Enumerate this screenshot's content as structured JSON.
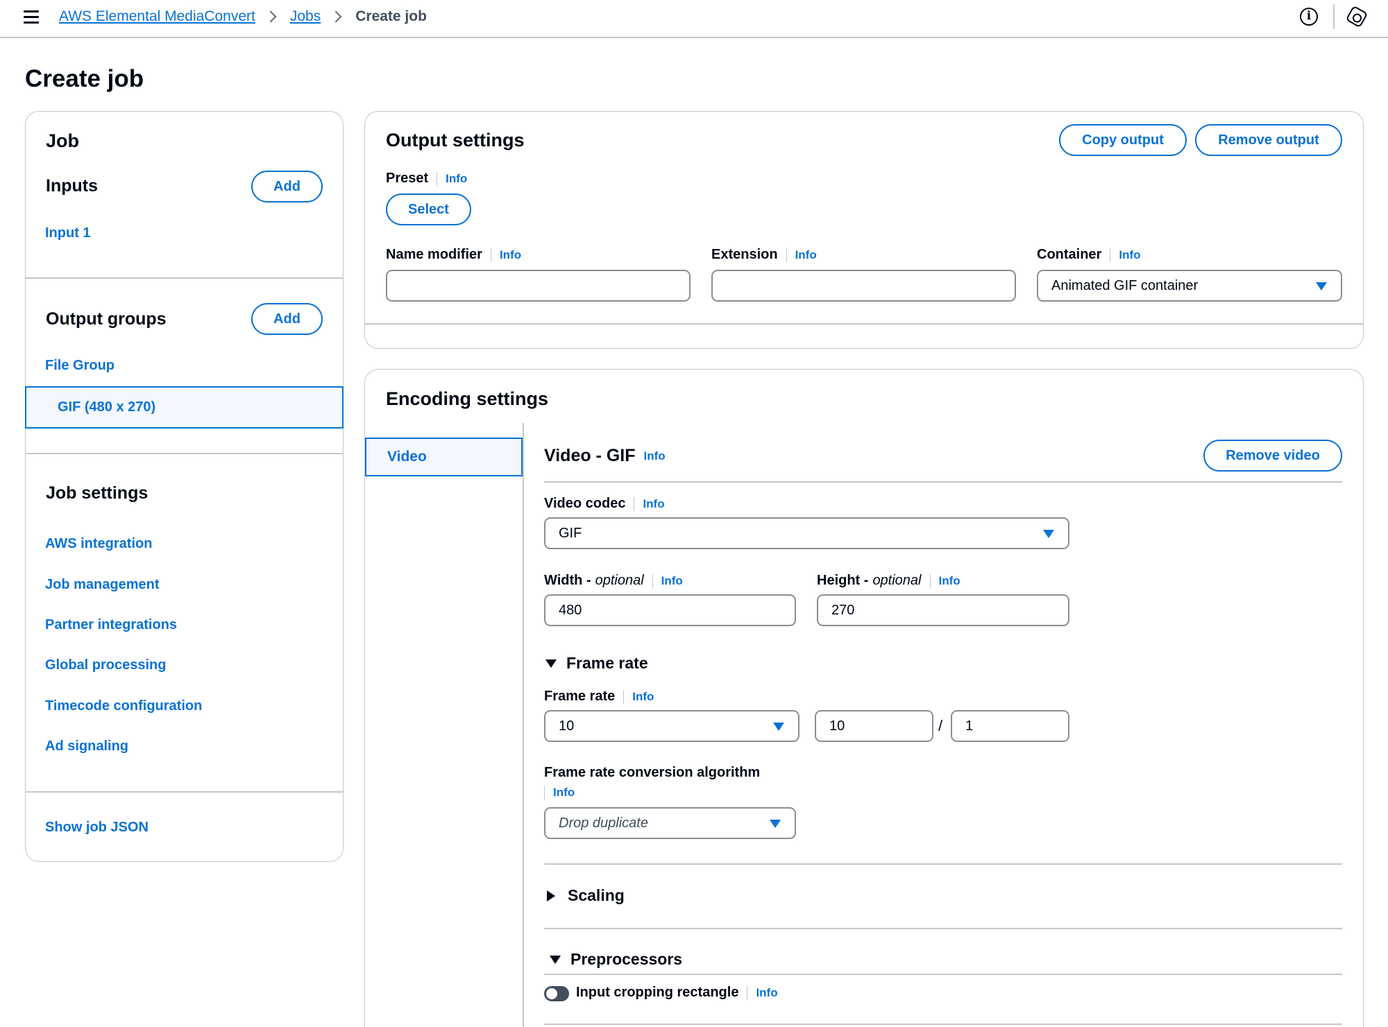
{
  "breadcrumb": {
    "items": [
      "AWS Elemental MediaConvert",
      "Jobs"
    ],
    "current": "Create job"
  },
  "page_title": "Create job",
  "left_panel": {
    "job_title": "Job",
    "inputs_title": "Inputs",
    "inputs_add": "Add",
    "input_items": [
      "Input 1"
    ],
    "output_groups_title": "Output groups",
    "output_groups_add": "Add",
    "output_group_items": [
      "File Group"
    ],
    "selected_output": "GIF (480 x 270)",
    "job_settings_title": "Job settings",
    "job_settings_items": [
      "AWS integration",
      "Job management",
      "Partner integrations",
      "Global processing",
      "Timecode configuration",
      "Ad signaling"
    ],
    "show_json": "Show job JSON"
  },
  "output_settings": {
    "title": "Output settings",
    "copy_output": "Copy output",
    "remove_output": "Remove output",
    "preset_label": "Preset",
    "info": "Info",
    "select_button": "Select",
    "name_modifier_label": "Name modifier",
    "name_modifier_value": "",
    "extension_label": "Extension",
    "extension_value": "",
    "container_label": "Container",
    "container_value": "Animated GIF container"
  },
  "encoding_settings": {
    "title": "Encoding settings",
    "tab_video": "Video",
    "video_title": "Video - GIF",
    "remove_video": "Remove video",
    "video_codec_label": "Video codec",
    "video_codec_value": "GIF",
    "width_label": "Width - ",
    "height_label": "Height - ",
    "optional": "optional",
    "width_value": "480",
    "height_value": "270",
    "frame_rate_section": "Frame rate",
    "frame_rate_label": "Frame rate",
    "frame_rate_value": "10",
    "frame_rate_numerator": "10",
    "frame_rate_slash": "/",
    "frame_rate_denominator": "1",
    "conversion_label": "Frame rate conversion algorithm",
    "conversion_value": "Drop duplicate",
    "scaling_section": "Scaling",
    "preprocessors_section": "Preprocessors",
    "input_cropping_label": "Input cropping rectangle"
  },
  "colors": {
    "accent": "#0972d3",
    "text": "#000716",
    "border": "#c6c6cd",
    "selected_bg": "#f2f8fd"
  }
}
